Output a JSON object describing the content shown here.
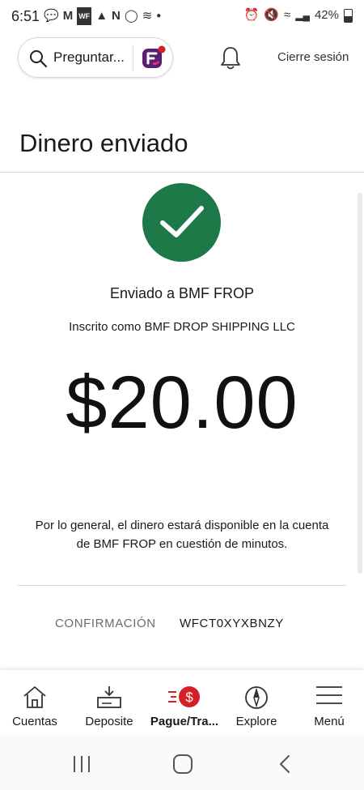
{
  "status_bar": {
    "time": "6:51",
    "battery": "42%",
    "left_icons": [
      "chat-icon",
      "gmail-icon",
      "wf-icon",
      "app-icon",
      "n-icon",
      "instagram-icon",
      "wallet-icon",
      "dot-icon"
    ],
    "right_icons": [
      "alarm-icon",
      "mute-icon",
      "wifi-icon",
      "signal-icon",
      "battery-icon"
    ]
  },
  "header": {
    "search_placeholder": "Preguntar...",
    "logout": "Cierre sesión",
    "brand_color": "#d71e28",
    "fargo_color": "#5a1e6e"
  },
  "page": {
    "title": "Dinero enviado"
  },
  "success": {
    "sent_to": "Enviado a BMF FROP",
    "enrolled_as": "Inscrito como BMF DROP SHIPPING LLC",
    "amount": "$20.00",
    "note": "Por lo general, el dinero estará disponible en la cuenta de BMF FROP en cuestión de minutos.",
    "check_color": "#1d7a48"
  },
  "confirmation": {
    "label": "CONFIRMACIÓN",
    "value": "WFCT0XYXBNZY"
  },
  "bottom_nav": {
    "items": [
      {
        "label": "Cuentas",
        "icon": "house-icon",
        "active": false
      },
      {
        "label": "Deposite",
        "icon": "deposit-icon",
        "active": false
      },
      {
        "label": "Pague/Tra...",
        "icon": "pay-transfer-icon",
        "active": true
      },
      {
        "label": "Explore",
        "icon": "compass-icon",
        "active": false
      },
      {
        "label": "Menú",
        "icon": "hamburger-icon",
        "active": false
      }
    ]
  },
  "system_nav": [
    "recents-icon",
    "home-icon",
    "back-icon"
  ]
}
